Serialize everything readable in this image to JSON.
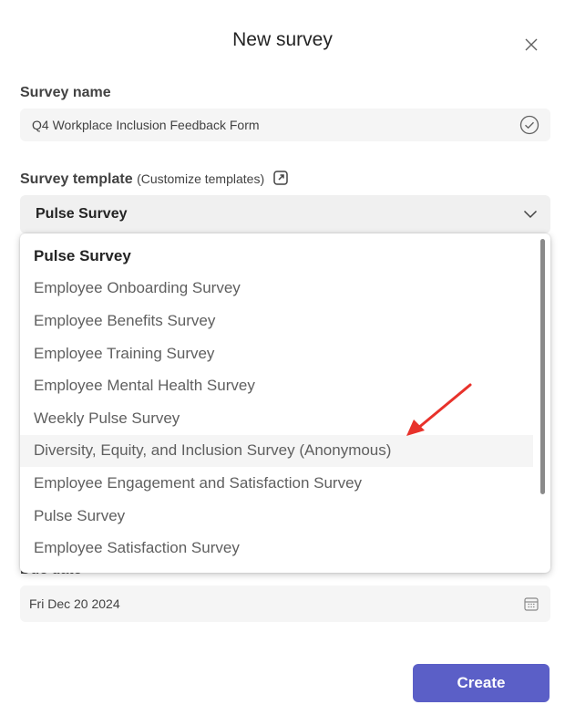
{
  "dialog": {
    "title": "New survey",
    "close_icon": "close-icon"
  },
  "survey_name": {
    "label": "Survey name",
    "value": "Q4 Workplace Inclusion Feedback Form",
    "status_icon": "check-circle-icon"
  },
  "survey_template": {
    "label": "Survey template",
    "customize_link": "(Customize templates)",
    "customize_icon": "open-external-icon",
    "selected_value": "Pulse Survey",
    "dropdown_icon": "chevron-down-icon",
    "options": [
      "Pulse Survey",
      "Employee Onboarding Survey",
      "Employee Benefits Survey",
      "Employee Training Survey",
      "Employee Mental Health Survey",
      "Weekly Pulse Survey",
      "Diversity, Equity, and Inclusion Survey (Anonymous)",
      "Employee Engagement and Satisfaction Survey",
      "Pulse Survey",
      "Employee Satisfaction Survey"
    ]
  },
  "due_date": {
    "label": "Due date",
    "value": "Fri Dec 20 2024",
    "icon": "calendar-icon"
  },
  "footer": {
    "create_label": "Create"
  },
  "annotation": {
    "arrow_color": "#e8322b"
  },
  "colors": {
    "accent": "#5b5fc7"
  }
}
